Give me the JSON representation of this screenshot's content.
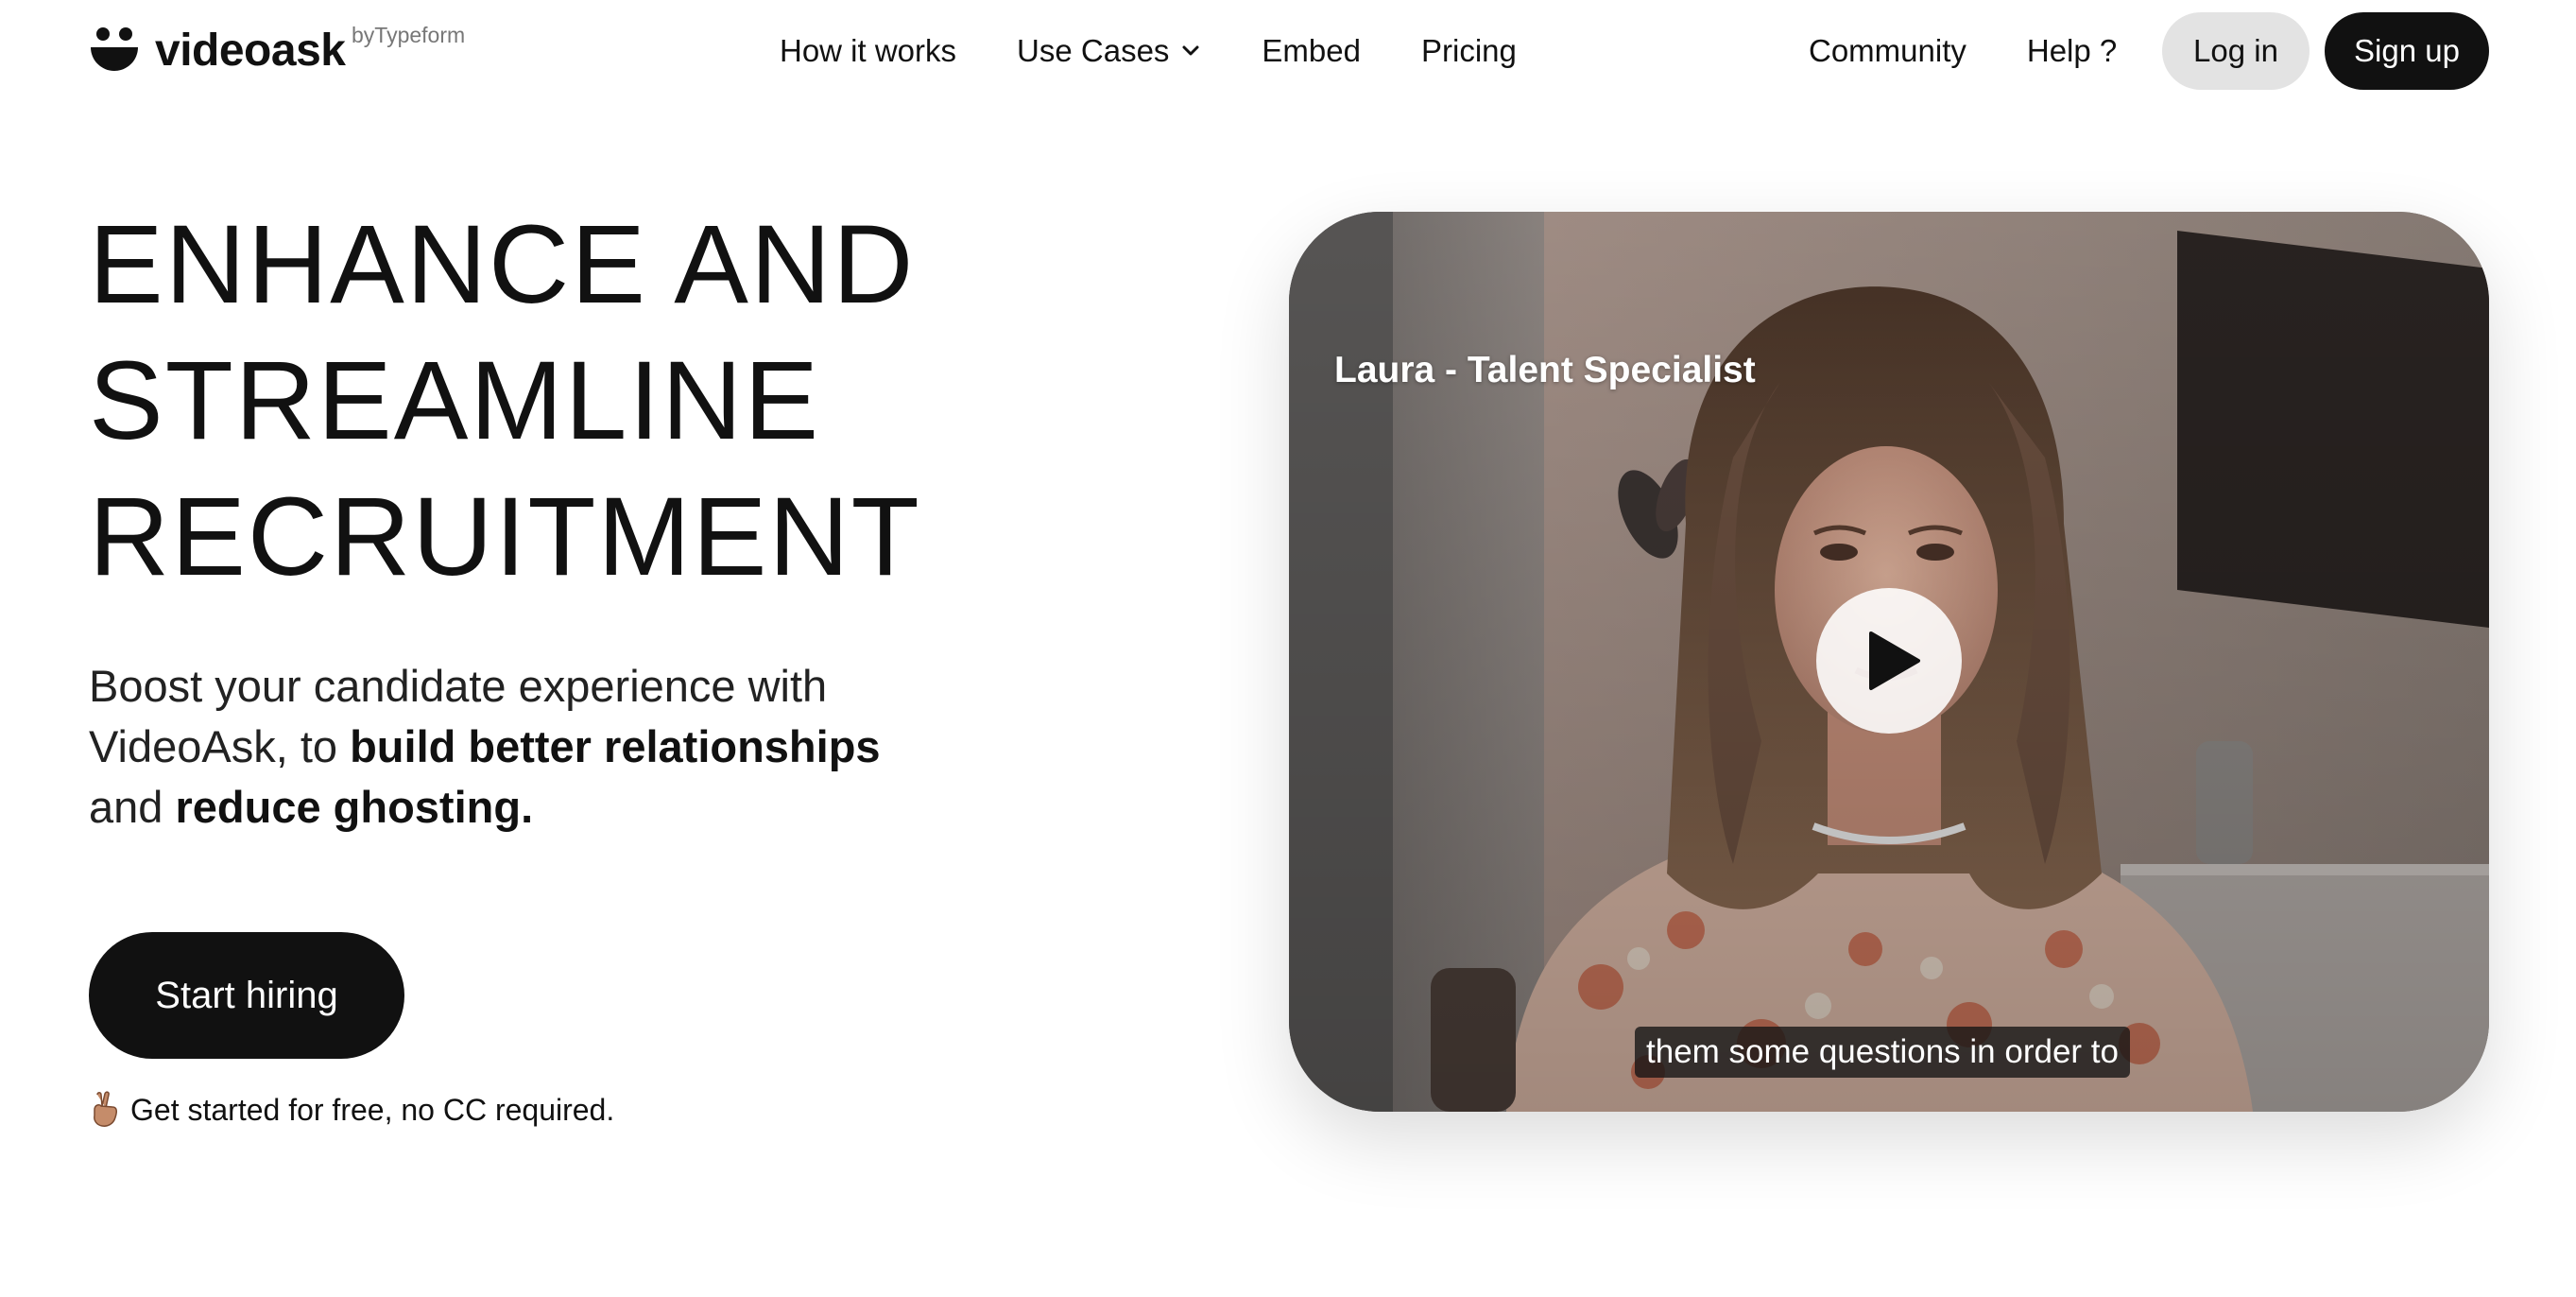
{
  "header": {
    "logo_text": "videoask",
    "logo_by": "byTypeform",
    "nav": [
      {
        "label": "How it works"
      },
      {
        "label": "Use Cases",
        "icon": "chevron-down-icon"
      },
      {
        "label": "Embed"
      },
      {
        "label": "Pricing"
      }
    ],
    "nav_right": [
      {
        "label": "Community"
      },
      {
        "label": "Help ?"
      }
    ],
    "login_label": "Log in",
    "signup_label": "Sign up"
  },
  "hero": {
    "title_lines": [
      "ENHANCE AND",
      "STREAMLINE",
      "RECRUITMENT"
    ],
    "subtitle": {
      "part1": "Boost your candidate experience with VideoAsk, to ",
      "bold1": "build better relationships",
      "part2": " and ",
      "bold2": "reduce ghosting."
    },
    "cta_label": "Start hiring",
    "free_note": "Get started for free, no CC required.",
    "free_note_icon": "victory-hand-icon"
  },
  "video": {
    "speaker_label": "Laura - Talent Specialist",
    "caption": "them some questions in order to",
    "play_icon": "play-icon"
  },
  "colors": {
    "primary": "#111111",
    "login_bg": "#e3e3e3",
    "background": "#ffffff"
  }
}
